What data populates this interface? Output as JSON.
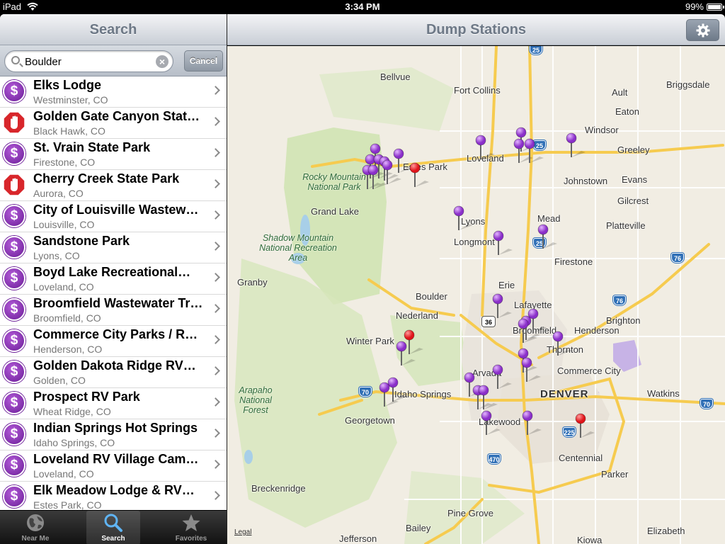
{
  "status": {
    "carrier": "iPad",
    "time": "3:34 PM",
    "battery": "99%"
  },
  "left": {
    "title": "Search",
    "search": {
      "value": "Boulder",
      "cancel": "Cancel"
    },
    "results": [
      {
        "icon": "dollar-icon",
        "name": "Elks Lodge",
        "loc": "Westminster, CO"
      },
      {
        "icon": "stop-hand-icon",
        "name": "Golden Gate Canyon Stat…",
        "loc": "Black Hawk, CO"
      },
      {
        "icon": "dollar-icon",
        "name": "St. Vrain State Park",
        "loc": "Firestone, CO"
      },
      {
        "icon": "stop-hand-icon",
        "name": "Cherry Creek State Park",
        "loc": "Aurora, CO"
      },
      {
        "icon": "dollar-icon",
        "name": "City of Louisville Wastew…",
        "loc": "Louisville, CO"
      },
      {
        "icon": "dollar-icon",
        "name": "Sandstone Park",
        "loc": "Lyons, CO"
      },
      {
        "icon": "dollar-icon",
        "name": "Boyd Lake Recreational…",
        "loc": "Loveland, CO"
      },
      {
        "icon": "dollar-icon",
        "name": "Broomfield Wastewater Tr…",
        "loc": "Broomfield, CO"
      },
      {
        "icon": "dollar-icon",
        "name": "Commerce City Parks / Re…",
        "loc": "Henderson, CO"
      },
      {
        "icon": "dollar-icon",
        "name": "Golden Dakota Ridge RV…",
        "loc": "Golden, CO"
      },
      {
        "icon": "dollar-icon",
        "name": "Prospect RV Park",
        "loc": "Wheat Ridge, CO"
      },
      {
        "icon": "dollar-icon",
        "name": "Indian Springs Hot Springs",
        "loc": "Idaho Springs, CO"
      },
      {
        "icon": "dollar-icon",
        "name": "Loveland RV Village Cam…",
        "loc": "Loveland, CO"
      },
      {
        "icon": "dollar-icon",
        "name": "Elk Meadow Lodge & RV…",
        "loc": "Estes Park, CO"
      }
    ],
    "tabs": [
      {
        "label": "Near Me",
        "icon": "globe-icon"
      },
      {
        "label": "Search",
        "icon": "search-icon",
        "active": true
      },
      {
        "label": "Favorites",
        "icon": "star-icon"
      }
    ]
  },
  "map": {
    "title": "Dump Stations",
    "legal": "Legal",
    "cities": [
      "Bellvue",
      "Fort Collins",
      "Ault",
      "Briggsdale",
      "Eaton",
      "Windsor",
      "Greeley",
      "Loveland",
      "Estes Park",
      "Johnstown",
      "Evans",
      "Gilcrest",
      "Grand Lake",
      "Mead",
      "Lyons",
      "Platteville",
      "Longmont",
      "Firestone",
      "Granby",
      "Erie",
      "Boulder",
      "Lafayette",
      "Nederland",
      "Brighton",
      "Broomfield",
      "Henderson",
      "Winter Park",
      "Thornton",
      "Arvada",
      "Commerce City",
      "Idaho Springs",
      "DENVER",
      "Watkins",
      "Georgetown",
      "Lakewood",
      "Centennial",
      "Parker",
      "Breckenridge",
      "Pine Grove",
      "Jefferson",
      "Bailey",
      "Elizabeth",
      "Kiowa"
    ],
    "parks": [
      "Rocky Mountain National Park",
      "Shadow Mountain National Recreation Area",
      "Arapaho National Forest"
    ],
    "highways": [
      "25",
      "25",
      "25",
      "76",
      "76",
      "36",
      "70",
      "70",
      "225",
      "470"
    ]
  },
  "colors": {
    "pin_purple": "#8a2fc9",
    "pin_red": "#e0141a",
    "park_green": "#cfe3b0",
    "road_yellow": "#f6cb4f"
  }
}
